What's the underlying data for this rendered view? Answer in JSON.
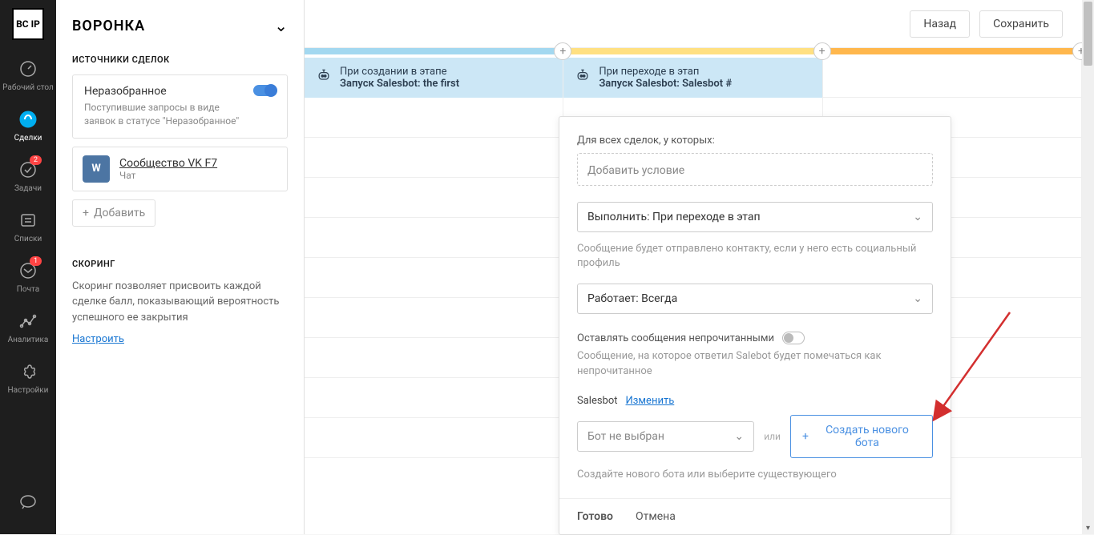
{
  "nav": {
    "logo": "BC\nIP",
    "items": [
      {
        "label": "Рабочий стол"
      },
      {
        "label": "Сделки"
      },
      {
        "label": "Задачи",
        "badge": "2"
      },
      {
        "label": "Списки"
      },
      {
        "label": "Почта",
        "badge": "1"
      },
      {
        "label": "Аналитика"
      },
      {
        "label": "Настройки"
      }
    ]
  },
  "sidebar": {
    "title": "ВОРОНКА",
    "sources_label": "ИСТОЧНИКИ СДЕЛОК",
    "unsorted": {
      "title": "Неразобранное",
      "desc": "Поступившие запросы в виде заявок в статусе \"Неразобранное\""
    },
    "vk": {
      "title": "Сообщество VK F7",
      "sub": "Чат"
    },
    "add_label": "Добавить",
    "scoring_label": "СКОРИНГ",
    "scoring_desc": "Скоринг позволяет присвоить каждой сделке балл, показывающий вероятность успешного ее закрытия",
    "scoring_link": "Настроить"
  },
  "header": {
    "back": "Назад",
    "save": "Сохранить"
  },
  "stages": {
    "col1": {
      "sub": "При создании в этапе",
      "title": "Запуск Salesbot: the first"
    },
    "col2": {
      "sub": "При переходе в этап",
      "title": "Запуск Salesbot: Salesbot #"
    }
  },
  "modal": {
    "for_all_label": "Для всех сделок, у которых:",
    "add_condition": "Добавить условие",
    "execute_select": "Выполнить: При переходе в этап",
    "execute_hint": "Сообщение будет отправлено контакту, если у него есть социальный профиль",
    "works_select": "Работает: Всегда",
    "unread_label": "Оставлять сообщения непрочитанными",
    "unread_hint": "Сообщение, на которое ответил Salebot будет помечаться как непрочитанное",
    "salesbot_label": "Salesbot",
    "change_link": "Изменить",
    "bot_select": "Бот не выбран",
    "or_label": "или",
    "create_bot": "Создать нового бота",
    "create_hint": "Создайте нового бота или выберите существующего",
    "done": "Готово",
    "cancel": "Отмена"
  }
}
